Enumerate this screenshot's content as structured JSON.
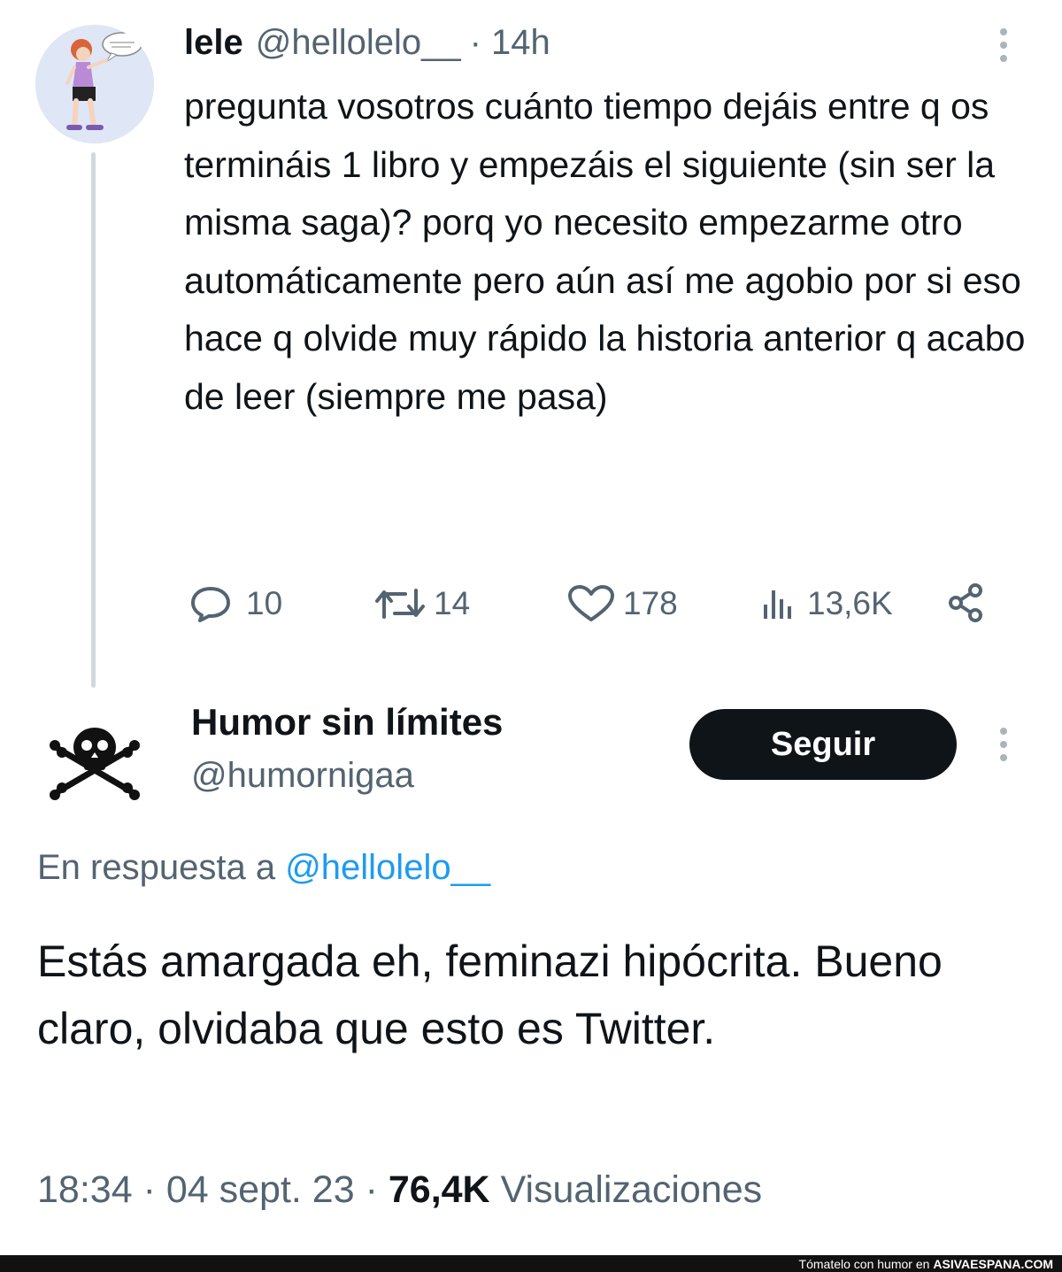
{
  "tweet1": {
    "author_name": "lele",
    "author_handle": "@hellolelo__",
    "time": "· 14h",
    "text": "pregunta vosotros cuánto tiempo dejáis entre q os termináis 1 libro y empezáis el siguiente (sin ser la misma saga)? porq yo necesito empezarme otro automáticamente pero aún así me agobio por si eso hace q olvide muy rápido la historia anterior q acabo de leer (siempre me pasa)",
    "actions": {
      "replies": "10",
      "retweets": "14",
      "likes": "178",
      "views": "13,6K"
    }
  },
  "tweet2": {
    "author_name": "Humor sin límites",
    "author_handle": "@humornigaa",
    "follow_label": "Seguir",
    "reply_prefix": "En respuesta a",
    "reply_mention": "@hellolelo__",
    "text": "Estás amargada eh, feminazi hipócrita. Bueno claro, olvidaba que esto es Twitter.",
    "time": "18:34",
    "date": "04 sept. 23",
    "views_count": "76,4K",
    "views_label": "Visualizaciones"
  },
  "footer": {
    "tagline": "Tómatelo con humor en",
    "site": "ASIVAESPANA.COM"
  },
  "colors": {
    "text_primary": "#0f1419",
    "text_secondary": "#536471",
    "link": "#1d9bf0",
    "button_bg": "#0f1419",
    "thread_line": "#cfd9de"
  },
  "icons": {
    "reply": "speech-bubble-icon",
    "retweet": "retweet-arrows-icon",
    "like": "heart-icon",
    "views": "bar-chart-icon",
    "share": "share-nodes-icon",
    "more": "vertical-ellipsis-icon",
    "avatar2": "skull-crossbones-icon"
  }
}
